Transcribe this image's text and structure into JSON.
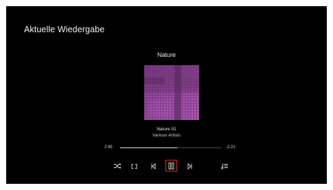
{
  "header": {
    "title": "Aktuelle Wiedergabe"
  },
  "player": {
    "playlist_title": "Nature",
    "album_art_icon": "album-art-image",
    "track": {
      "title": "Nature 01",
      "artist": "Various Artists"
    },
    "progress": {
      "elapsed": "2:45",
      "remaining": "-2:21",
      "fraction": 0.56
    },
    "controls": [
      {
        "name": "shuffle-icon"
      },
      {
        "name": "repeat-icon"
      },
      {
        "name": "previous-track-icon"
      },
      {
        "name": "pause-icon"
      },
      {
        "name": "next-track-icon"
      },
      {
        "name": "queue-icon"
      }
    ]
  },
  "colors": {
    "background": "#000000",
    "text": "#ffffff",
    "accent_focus": "#e0321e",
    "art_purple": "#a04aa8"
  }
}
